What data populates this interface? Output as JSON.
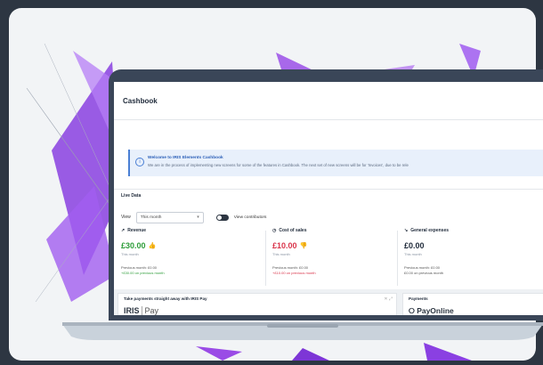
{
  "app": {
    "title": "Cashbook"
  },
  "notice": {
    "title": "Welcome to IRIS Elements Cashbook",
    "body": "We are in the process of implementing new screens for some of the features in Cashbook. The next set of new screens will be for 'Invoices', due to be rele"
  },
  "live_data": {
    "label": "Live Data",
    "view_label": "View",
    "view_select": "This month",
    "contributors_label": "View contributors"
  },
  "metrics": [
    {
      "title": "Revenue",
      "value": "£30.00",
      "period": "This month",
      "previous": "Previous month: £0.00",
      "change": "+£30.00  on previous month",
      "value_color": "#2e9d3a",
      "change_color": "#2e9d3a"
    },
    {
      "title": "Cost of sales",
      "value": "£10.00",
      "period": "This month",
      "previous": "Previous month: £0.00",
      "change": "+£10.00  on previous month",
      "value_color": "#d9344a",
      "change_color": "#d9344a"
    },
    {
      "title": "General expenses",
      "value": "£0.00",
      "period": "This month",
      "previous": "Previous month: £0.00",
      "change": "£0.00  on previous month",
      "value_color": "#1f2a3a",
      "change_color": "#555555"
    }
  ],
  "payments_card": {
    "title": "Take payments straight away with IRIS Pay",
    "logo_iris": "IRIS",
    "logo_pay": "Pay"
  },
  "payments_panel": {
    "title": "Payments",
    "logo": "PayOnline"
  }
}
